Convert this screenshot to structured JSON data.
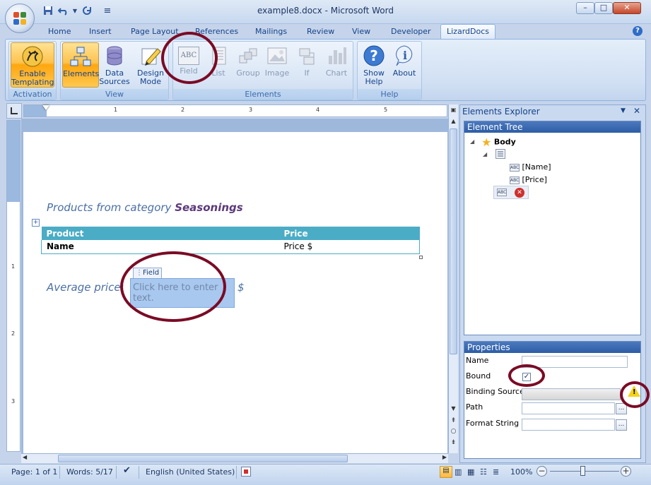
{
  "window": {
    "title": "example8.docx - Microsoft Word"
  },
  "qat": {
    "save_icon": "save-icon",
    "undo_icon": "undo-icon",
    "redo_icon": "redo-icon",
    "customize": "≡"
  },
  "tabs": [
    "Home",
    "Insert",
    "Page Layout",
    "References",
    "Mailings",
    "Review",
    "View",
    "Developer",
    "LizardDocs"
  ],
  "active_tab": "LizardDocs",
  "ribbon": {
    "groups": [
      {
        "label": "Activation",
        "buttons": [
          {
            "label": "Enable\nTemplating"
          }
        ]
      },
      {
        "label": "View",
        "buttons": [
          {
            "label": "Elements"
          },
          {
            "label": "Data\nSources"
          },
          {
            "label": "Design\nMode"
          }
        ]
      },
      {
        "label": "Elements",
        "buttons": [
          {
            "label": "Field"
          },
          {
            "label": "List"
          },
          {
            "label": "Group"
          },
          {
            "label": "Image"
          },
          {
            "label": "If"
          },
          {
            "label": "Chart"
          }
        ]
      },
      {
        "label": "Help",
        "buttons": [
          {
            "label": "Show\nHelp"
          },
          {
            "label": "About"
          }
        ]
      }
    ],
    "field_icon_text": "ABC"
  },
  "ruler": {
    "numbers": [
      "1",
      "2",
      "3",
      "4",
      "5"
    ],
    "vnumbers": [
      "1",
      "2",
      "3"
    ]
  },
  "document": {
    "heading_prefix": "Products from  category ",
    "heading_category": "Seasonings",
    "table_headers": [
      "Product",
      "Price"
    ],
    "table_row": [
      "Name",
      "Price $"
    ],
    "avg_label": "Average price:",
    "field_tag": "Field",
    "field_placeholder": "Click here to enter text.",
    "currency": "$"
  },
  "explorer": {
    "title": "Elements Explorer",
    "tree_header": "Element Tree",
    "tree": {
      "root": "Body",
      "children": [
        "[Name]",
        "[Price]"
      ]
    },
    "abc_text": "ABC",
    "properties_header": "Properties",
    "properties": [
      {
        "label": "Name",
        "value": ""
      },
      {
        "label": "Bound",
        "checked": true
      },
      {
        "label": "Binding Source",
        "value": ""
      },
      {
        "label": "Path",
        "value": ""
      },
      {
        "label": "Format String",
        "value": ""
      }
    ],
    "ellipsis": "..."
  },
  "status": {
    "page": "Page: 1 of 1",
    "words": "Words: 5/17",
    "language": "English (United States)",
    "zoom": "100%",
    "zoom_minus": "−",
    "zoom_plus": "+"
  }
}
